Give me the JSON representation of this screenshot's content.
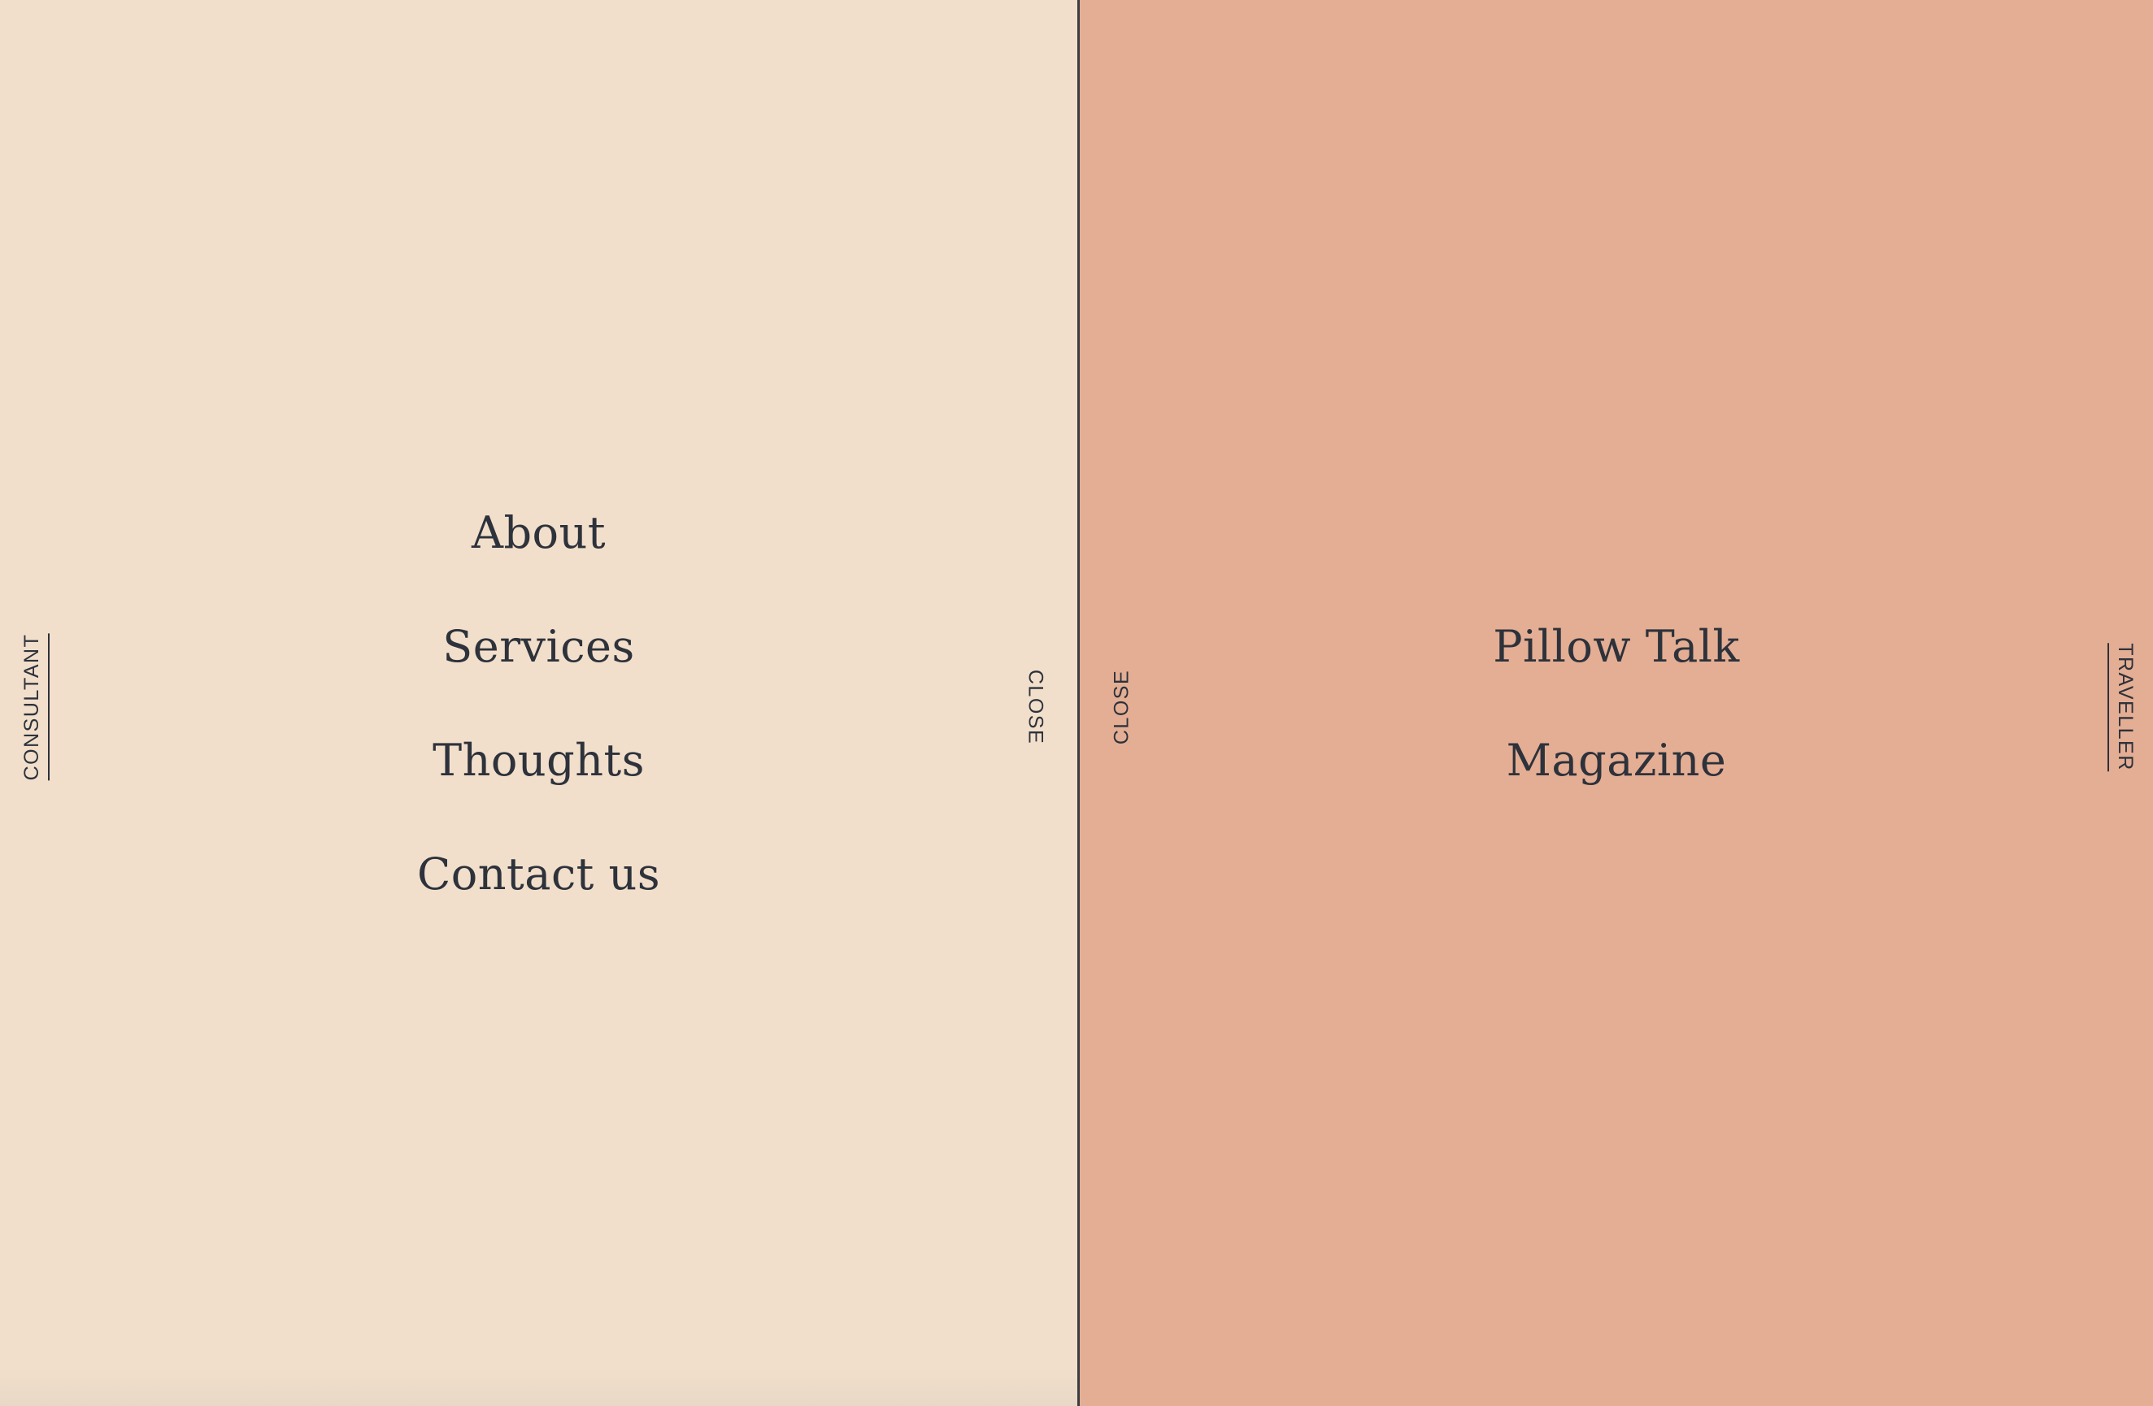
{
  "colors": {
    "left_panel_bg": "#f2dfcb",
    "right_panel_bg": "#e4ae94",
    "text": "#2d323b",
    "divider": "#3a3c42"
  },
  "left_panel": {
    "side_label": "CONSULTANT",
    "close_label": "CLOSE",
    "menu": [
      "About",
      "Services",
      "Thoughts",
      "Contact us"
    ]
  },
  "right_panel": {
    "side_label": "TRAVELLER",
    "close_label": "CLOSE",
    "menu": [
      "Pillow Talk",
      "Magazine"
    ]
  }
}
